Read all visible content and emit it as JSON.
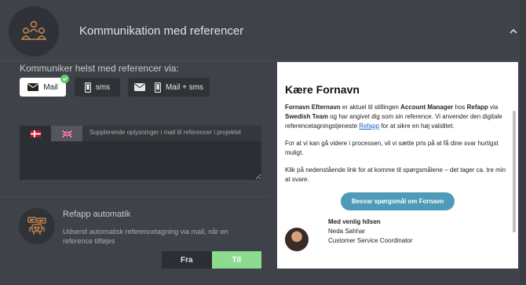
{
  "header": {
    "title": "Kommunikation med referencer",
    "icon": "people-group-icon",
    "toggle_icon": "chevron-up-icon"
  },
  "channels": {
    "label": "Kommuniker helst med referencer via:",
    "options": [
      {
        "label": "Mail",
        "icon": "envelope-icon",
        "selected": true
      },
      {
        "label": "sms",
        "icon": "phone-icon",
        "selected": false
      },
      {
        "label": "Mail + sms",
        "icon": "envelope-phone-icon",
        "selected": false
      }
    ]
  },
  "extra_info": {
    "languages": [
      "Danish",
      "English"
    ],
    "active_language": "Danish",
    "placeholder": "Supplerende oplysninger i mail til referencer i projektet",
    "value": ""
  },
  "automatic": {
    "title": "Refapp automatik",
    "description": "Udsend automatisk referencetagning via mail, når en reference tilføjes",
    "icon": "robot-icon",
    "toggle": {
      "off_label": "Fra",
      "on_label": "Til",
      "value": "Til"
    }
  },
  "preview": {
    "heading": "Kære Fornavn",
    "p1": {
      "a": "Fornavn Efternavn",
      "b": " er aktuel til stillingen ",
      "c": "Account Manager",
      "d": " hos ",
      "e": "Refapp",
      "f": " via ",
      "g": "Swedish Team",
      "h": " og har angivet dig som sin reference. Vi anvender den digitale referencetagningstjeneste ",
      "link": "Refapp",
      "i": " for at sikre en høj validitet."
    },
    "p2": "For at vi kan gå videre i processen, vil vi sætte pris på at få dine svar hurtigst muligt.",
    "p3": "Klik på nedenstående link for at komme til spørgsmålene – det tager ca. tre min at svare.",
    "button": "Besvar spørgsmål om Fornavn",
    "signature": {
      "greeting": "Med venlig hilsen",
      "name": "Neda Sahhar",
      "role": "Customer Service Coordinator"
    }
  },
  "colors": {
    "background": "#3f4248",
    "panel_dark": "#2b2e33",
    "accent_orange": "#d08a4e",
    "toggle_on": "#8bdc8f",
    "cta": "#4d9bb8",
    "check": "#5fc86a"
  }
}
